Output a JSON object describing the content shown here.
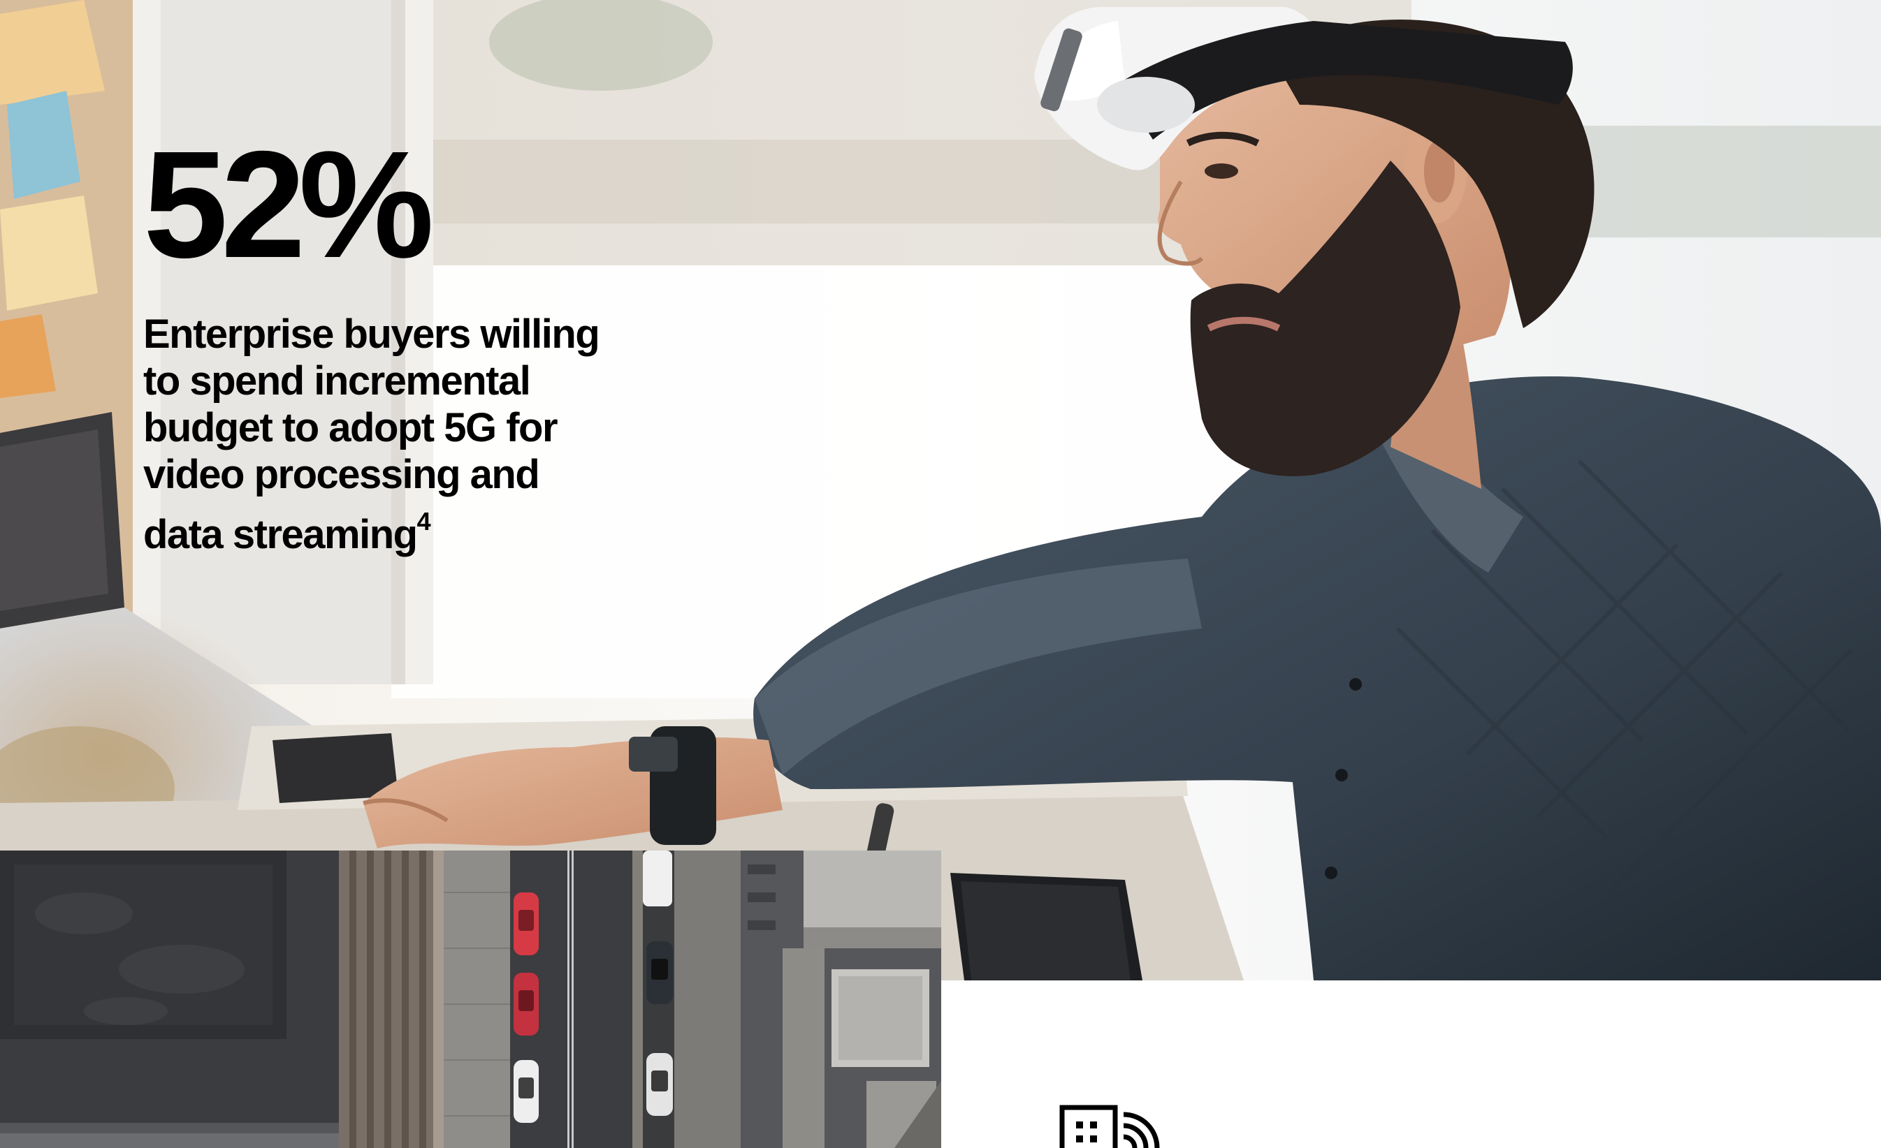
{
  "stat": {
    "value": "52%",
    "caption_lines": [
      "Enterprise buyers willing",
      "to spend incremental",
      "budget to adopt 5G for",
      "video processing and",
      "data streaming"
    ],
    "footnote": "4"
  },
  "icons": {
    "hero_photo": "man-wearing-vr-headset-photo",
    "aerial_photo": "aerial-city-street-photo",
    "feature_icon": "building-wireless-signal-icon"
  },
  "colors": {
    "text": "#000000",
    "background": "#ffffff"
  }
}
